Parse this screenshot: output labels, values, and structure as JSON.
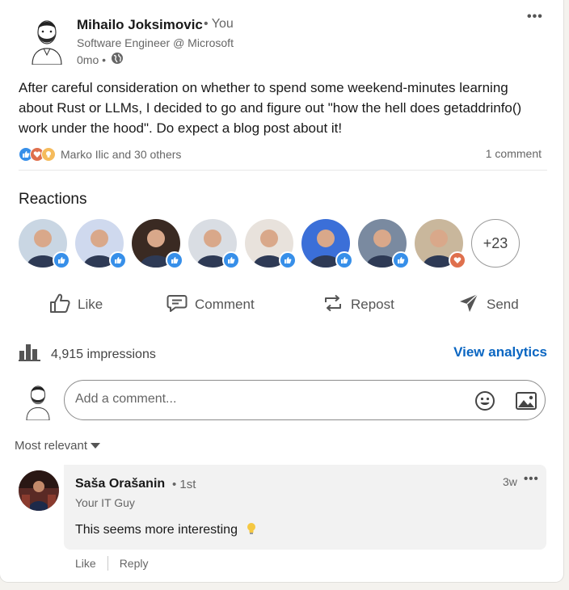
{
  "post": {
    "author_name": "Mihailo Joksimovic",
    "author_relation": "• You",
    "author_headline": "Software Engineer @ Microsoft",
    "time": "0mo •",
    "more_label": "•••",
    "text": "After careful consideration on whether to spend some weekend-minutes learning about Rust or LLMs, I decided to go and figure out \"how the hell does getaddrinfo() work under the hood\". Do expect a blog post about it!",
    "reactors_summary": "Marko Ilic and 30 others",
    "comments_count": "1 comment"
  },
  "reactions": {
    "title": "Reactions",
    "more_count": "+23",
    "reactors": [
      {
        "reaction": "like-icon",
        "bg": "#c9d6e3"
      },
      {
        "reaction": "like-icon",
        "bg": "#cfd9ee"
      },
      {
        "reaction": "like-icon",
        "bg": "#3a2a22"
      },
      {
        "reaction": "like-icon",
        "bg": "#d9dde3"
      },
      {
        "reaction": "like-icon",
        "bg": "#e8e2dc"
      },
      {
        "reaction": "like-icon",
        "bg": "#3b6fd8"
      },
      {
        "reaction": "like-icon",
        "bg": "#7a8aa0"
      },
      {
        "reaction": "love-icon",
        "bg": "#c9b79c"
      }
    ]
  },
  "actions": {
    "like": "Like",
    "comment": "Comment",
    "repost": "Repost",
    "send": "Send"
  },
  "analytics": {
    "impressions": "4,915 impressions",
    "view_label": "View analytics"
  },
  "comment_box": {
    "placeholder": "Add a comment..."
  },
  "sort": {
    "label": "Most relevant"
  },
  "comment": {
    "author_name": "Saša Orašanin",
    "degree": "• 1st",
    "headline": "Your IT Guy",
    "time": "3w",
    "more_label": "•••",
    "text": "This seems more interesting",
    "like_label": "Like",
    "reply_label": "Reply"
  },
  "colors": {
    "accent": "#0a66c2",
    "like_badge": "#378fe9",
    "love_badge": "#df704d",
    "bubble_bg": "#f2f2f2"
  }
}
